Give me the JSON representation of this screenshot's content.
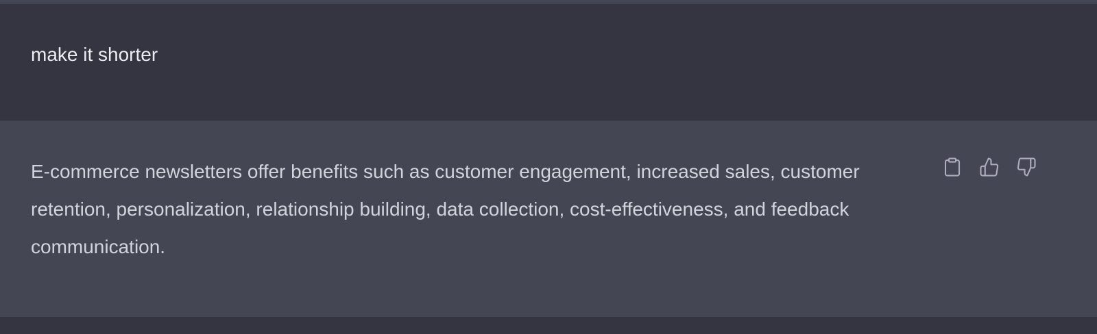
{
  "conversation": {
    "user_message": "make it shorter",
    "assistant_message": "E-commerce newsletters offer benefits such as customer engagement, increased sales, customer retention, personalization, relationship building, data collection, cost-effectiveness, and feedback communication."
  },
  "actions": [
    {
      "icon": "clipboard-icon",
      "label": "Copy"
    },
    {
      "icon": "thumbs-up-icon",
      "label": "Good response"
    },
    {
      "icon": "thumbs-down-icon",
      "label": "Bad response"
    }
  ],
  "colors": {
    "page_background": "#343541",
    "assistant_background": "#444654",
    "user_text": "#ececf1",
    "assistant_text": "#d1d5db",
    "icon": "#acacbe"
  }
}
